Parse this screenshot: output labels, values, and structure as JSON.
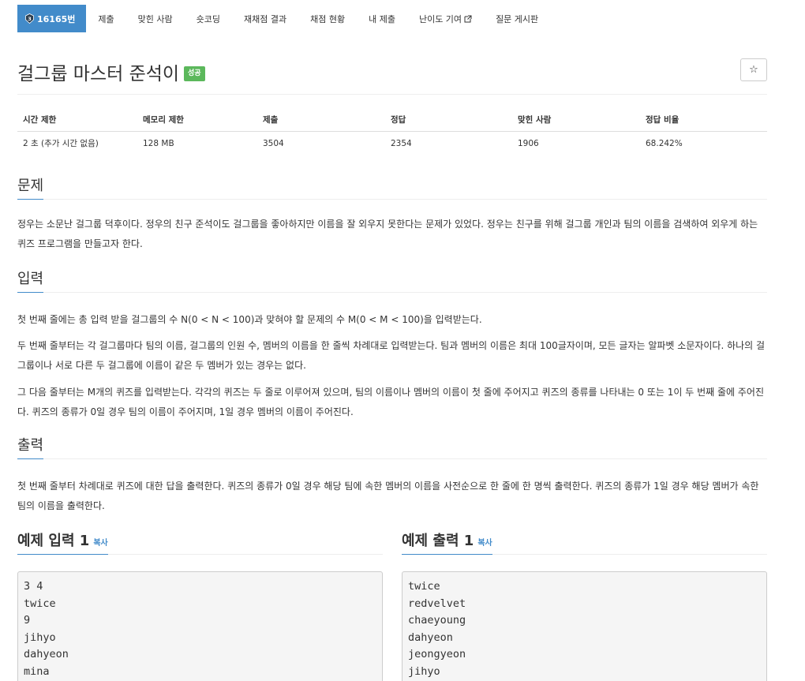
{
  "nav": {
    "items": [
      {
        "label": "16165번",
        "active": true
      },
      {
        "label": "제출"
      },
      {
        "label": "맞힌 사람"
      },
      {
        "label": "숏코딩"
      },
      {
        "label": "재채점 결과"
      },
      {
        "label": "채점 현황"
      },
      {
        "label": "내 제출"
      },
      {
        "label": "난이도 기여",
        "external": true
      },
      {
        "label": "질문 게시판"
      }
    ]
  },
  "problem": {
    "title": "걸그룹 마스터 준석이",
    "result_badge": "성공"
  },
  "info_table": {
    "headers": [
      "시간 제한",
      "메모리 제한",
      "제출",
      "정답",
      "맞힌 사람",
      "정답 비율"
    ],
    "row": [
      "2 초 (추가 시간 없음)",
      "128 MB",
      "3504",
      "2354",
      "1906",
      "68.242%"
    ]
  },
  "sections": {
    "problem": {
      "heading": "문제",
      "paragraphs": [
        "정우는 소문난 걸그룹 덕후이다. 정우의 친구 준석이도 걸그룹을 좋아하지만 이름을 잘 외우지 못한다는 문제가 있었다. 정우는 친구를 위해 걸그룹 개인과 팀의 이름을 검색하여 외우게 하는 퀴즈 프로그램을 만들고자 한다."
      ]
    },
    "input": {
      "heading": "입력",
      "paragraphs": [
        "첫 번째 줄에는 총 입력 받을 걸그룹의 수 N(0 < N < 100)과 맞혀야 할 문제의 수 M(0 < M < 100)을 입력받는다.",
        "두 번째 줄부터는 각 걸그룹마다 팀의 이름, 걸그룹의 인원 수, 멤버의 이름을 한 줄씩 차례대로 입력받는다. 팀과 멤버의 이름은 최대 100글자이며, 모든 글자는 알파벳 소문자이다. 하나의 걸그룹이나 서로 다른 두 걸그룹에 이름이 같은 두 멤버가 있는 경우는 없다.",
        "그 다음 줄부터는 M개의 퀴즈를 입력받는다. 각각의 퀴즈는 두 줄로 이루어져 있으며, 팀의 이름이나 멤버의 이름이 첫 줄에 주어지고 퀴즈의 종류를 나타내는 0 또는 1이 두 번째 줄에 주어진다. 퀴즈의 종류가 0일 경우 팀의 이름이 주어지며, 1일 경우 멤버의 이름이 주어진다."
      ]
    },
    "output": {
      "heading": "출력",
      "paragraphs": [
        "첫 번째 줄부터 차례대로 퀴즈에 대한 답을 출력한다. 퀴즈의 종류가 0일 경우 해당 팀에 속한 멤버의 이름을 사전순으로 한 줄에 한 명씩 출력한다. 퀴즈의 종류가 1일 경우 해당 멤버가 속한 팀의 이름을 출력한다."
      ]
    }
  },
  "samples": {
    "input": {
      "heading": "예제 입력 1",
      "copy_label": "복사",
      "lines": [
        "3 4",
        "twice",
        "9",
        "jihyo",
        "dahyeon",
        "mina"
      ]
    },
    "output": {
      "heading": "예제 출력 1",
      "copy_label": "복사",
      "lines": [
        "twice",
        "redvelvet",
        "chaeyoung",
        "dahyeon",
        "jeongyeon",
        "jihyo"
      ]
    }
  },
  "colors": {
    "primary": "#428bca",
    "success": "#5cb85c"
  },
  "icons": {
    "problem_badge": "tier-badge-icon",
    "external_link": "external-link-icon",
    "star": "star-icon"
  }
}
